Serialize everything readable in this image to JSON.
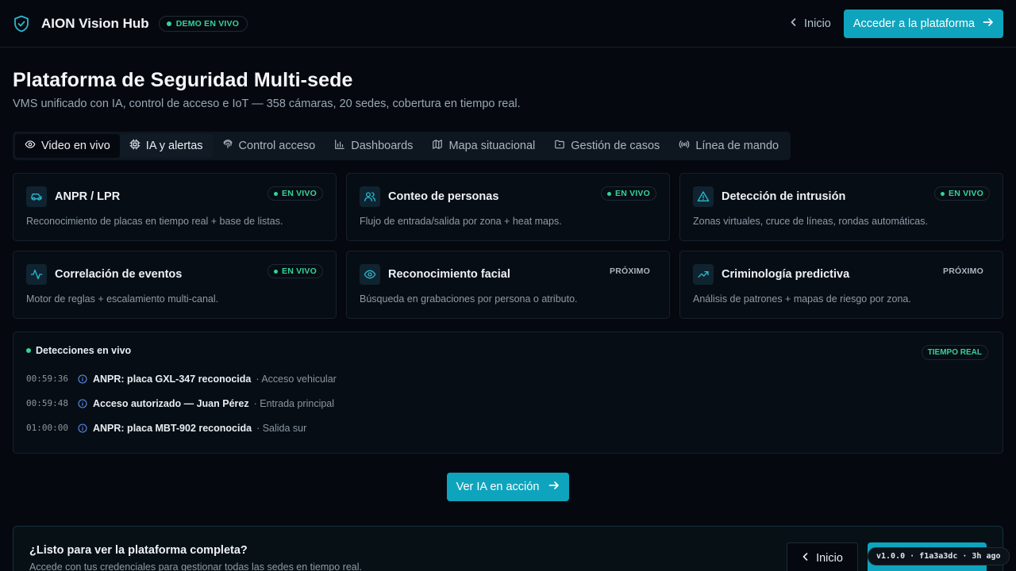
{
  "header": {
    "brand": "AION Vision Hub",
    "demo_badge": "DEMO EN VIVO",
    "back_label": "Inicio",
    "cta_label": "Acceder a la plataforma"
  },
  "page": {
    "title": "Plataforma de Seguridad Multi-sede",
    "subtitle": "VMS unificado con IA, control de acceso e IoT — 358 cámaras, 20 sedes, cobertura en tiempo real."
  },
  "tabs": [
    {
      "label": "Video en vivo",
      "icon": "eye-icon",
      "active": true
    },
    {
      "label": "IA y alertas",
      "icon": "cpu-icon",
      "active": false
    },
    {
      "label": "Control acceso",
      "icon": "fingerprint-icon",
      "active": false
    },
    {
      "label": "Dashboards",
      "icon": "bar-chart-icon",
      "active": false
    },
    {
      "label": "Mapa situacional",
      "icon": "map-icon",
      "active": false
    },
    {
      "label": "Gestión de casos",
      "icon": "folder-icon",
      "active": false
    },
    {
      "label": "Línea de mando",
      "icon": "radio-icon",
      "active": false
    }
  ],
  "cards": [
    {
      "title": "ANPR / LPR",
      "desc": "Reconocimiento de placas en tiempo real + base de listas.",
      "status": "EN VIVO",
      "icon": "car-icon"
    },
    {
      "title": "Conteo de personas",
      "desc": "Flujo de entrada/salida por zona + heat maps.",
      "status": "EN VIVO",
      "icon": "users-icon"
    },
    {
      "title": "Detección de intrusión",
      "desc": "Zonas virtuales, cruce de líneas, rondas automáticas.",
      "status": "EN VIVO",
      "icon": "warning-icon"
    },
    {
      "title": "Correlación de eventos",
      "desc": "Motor de reglas + escalamiento multi-canal.",
      "status": "EN VIVO",
      "icon": "activity-icon"
    },
    {
      "title": "Reconocimiento facial",
      "desc": "Búsqueda en grabaciones por persona o atributo.",
      "status": "PRÓXIMO",
      "icon": "eye-icon"
    },
    {
      "title": "Criminología predictiva",
      "desc": "Análisis de patrones + mapas de riesgo por zona.",
      "status": "PRÓXIMO",
      "icon": "trending-up-icon"
    }
  ],
  "detections": {
    "title": "Detecciones en vivo",
    "badge": "TIEMPO REAL",
    "items": [
      {
        "time": "00:59:36",
        "text": "ANPR: placa GXL-347 reconocida",
        "location": "· Acceso vehicular"
      },
      {
        "time": "00:59:48",
        "text": "Acceso autorizado — Juan Pérez",
        "location": "· Entrada principal"
      },
      {
        "time": "01:00:00",
        "text": "ANPR: placa MBT-902 reconocida",
        "location": "· Salida sur"
      }
    ]
  },
  "action": {
    "label": "Ver IA en acción"
  },
  "cta": {
    "title": "¿Listo para ver la plataforma completa?",
    "subtitle": "Accede con tus credenciales para gestionar todas las sedes en tiempo real.",
    "back_label": "Inicio"
  },
  "version": "v1.0.0 · f1a3a3dc · 3h ago",
  "colors": {
    "accent": "#0fa4bd",
    "live": "#34d399",
    "background": "#05090f"
  }
}
